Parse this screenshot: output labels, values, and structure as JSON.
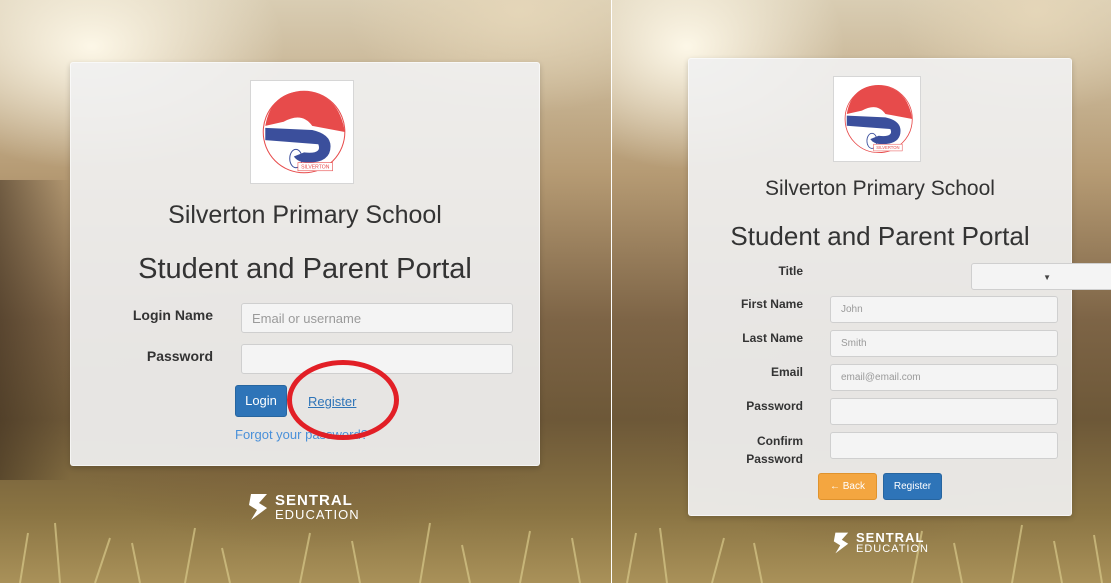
{
  "colors": {
    "primary": "#2e74b8",
    "warning": "#f4a640",
    "link": "#2e74b8",
    "highlight": "#e21f26",
    "logo_red": "#e74b4b",
    "logo_blue": "#3b4f9c"
  },
  "logo": {
    "text": "SILVERTON"
  },
  "login": {
    "school_name": "Silverton Primary School",
    "portal_name": "Student and Parent Portal",
    "login_name_label": "Login Name",
    "login_name_placeholder": "Email or username",
    "password_label": "Password",
    "login_button": "Login",
    "register_link": "Register",
    "forgot_link": "Forgot your password?"
  },
  "register": {
    "school_name": "Silverton Primary School",
    "portal_name": "Student and Parent Portal",
    "title_label": "Title",
    "first_name_label": "First Name",
    "first_name_placeholder": "John",
    "last_name_label": "Last Name",
    "last_name_placeholder": "Smith",
    "email_label": "Email",
    "email_placeholder": "email@email.com",
    "password_label": "Password",
    "confirm_password_label_line1": "Confirm",
    "confirm_password_label_line2": "Password",
    "back_button": "Back",
    "back_icon": "arrow-left-icon",
    "register_button": "Register"
  },
  "brand": {
    "line1": "SENTRAL",
    "line2": "EDUCATION"
  }
}
